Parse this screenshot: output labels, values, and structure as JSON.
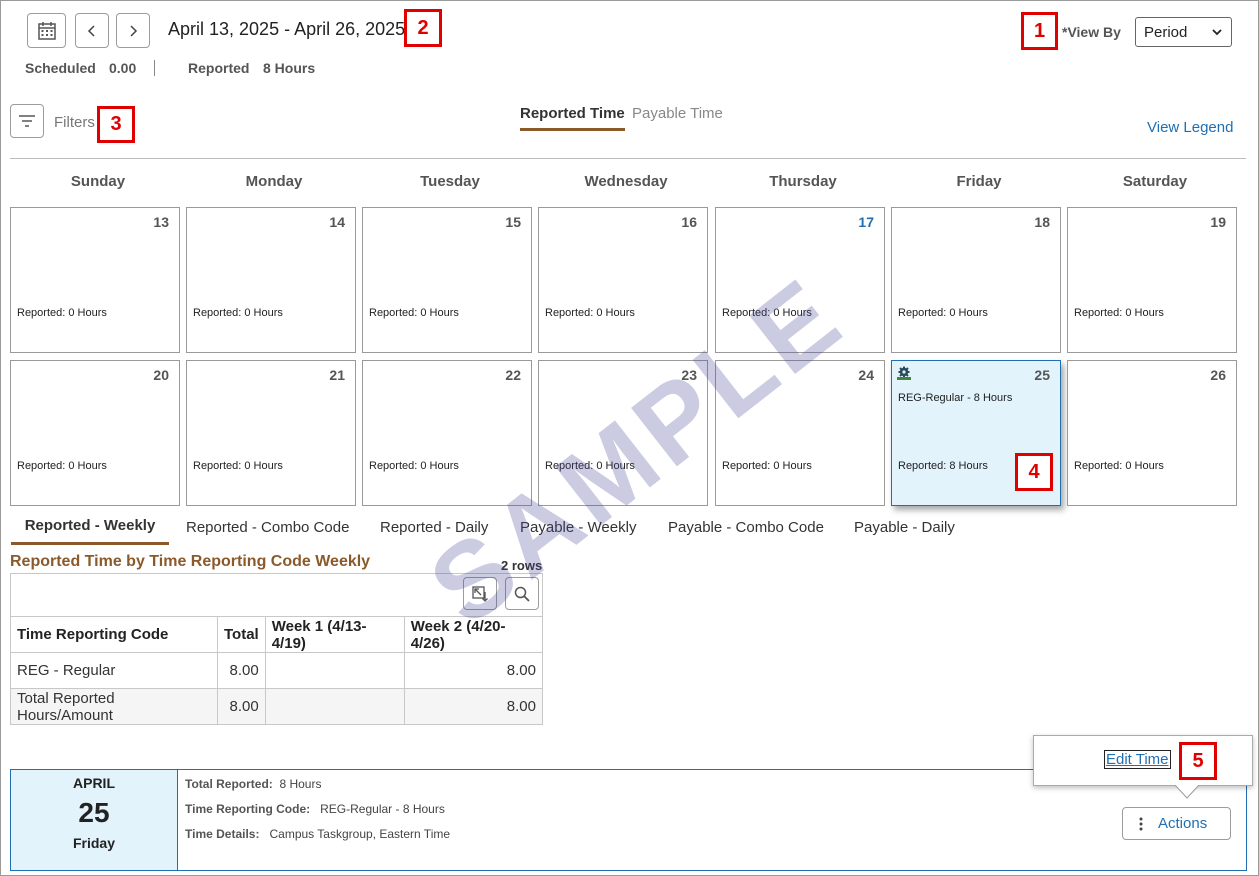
{
  "header": {
    "date_range": "April 13, 2025 - April 26, 2025",
    "view_by_label": "*View By",
    "view_by_value": "Period",
    "scheduled_label": "Scheduled",
    "scheduled_value": "0.00",
    "reported_label": "Reported",
    "reported_value": "8 Hours"
  },
  "filters_label": "Filters",
  "time_tabs": [
    "Reported Time",
    "Payable Time"
  ],
  "view_legend": "View Legend",
  "days": [
    "Sunday",
    "Monday",
    "Tuesday",
    "Wednesday",
    "Thursday",
    "Friday",
    "Saturday"
  ],
  "week1": [
    {
      "num": "13",
      "rep": "Reported: 0 Hours"
    },
    {
      "num": "14",
      "rep": "Reported: 0 Hours"
    },
    {
      "num": "15",
      "rep": "Reported: 0 Hours"
    },
    {
      "num": "16",
      "rep": "Reported: 0 Hours"
    },
    {
      "num": "17",
      "rep": "Reported: 0 Hours"
    },
    {
      "num": "18",
      "rep": "Reported: 0 Hours"
    },
    {
      "num": "19",
      "rep": "Reported: 0 Hours"
    }
  ],
  "week2": [
    {
      "num": "20",
      "rep": "Reported: 0 Hours"
    },
    {
      "num": "21",
      "rep": "Reported: 0 Hours"
    },
    {
      "num": "22",
      "rep": "Reported: 0 Hours"
    },
    {
      "num": "23",
      "rep": "Reported: 0 Hours"
    },
    {
      "num": "24",
      "rep": "Reported: 0 Hours"
    },
    {
      "num": "25",
      "rep": "Reported: 8 Hours",
      "entry": "REG-Regular - 8 Hours"
    },
    {
      "num": "26",
      "rep": "Reported: 0 Hours"
    }
  ],
  "summary_tabs": [
    "Reported - Weekly",
    "Reported - Combo Code",
    "Reported - Daily",
    "Payable - Weekly",
    "Payable - Combo Code",
    "Payable - Daily"
  ],
  "grid": {
    "title": "Reported Time by Time Reporting Code Weekly",
    "row_count": "2 rows",
    "headers": [
      "Time Reporting Code",
      "Total",
      "Week 1 (4/13-4/19)",
      "Week 2 (4/20-4/26)"
    ],
    "rows": [
      [
        "REG - Regular",
        "8.00",
        "",
        "8.00"
      ],
      [
        "Total Reported Hours/Amount",
        "8.00",
        "",
        "8.00"
      ]
    ]
  },
  "detail": {
    "month": "APRIL",
    "day": "25",
    "weekday": "Friday",
    "total_label": "Total Reported:",
    "total_value": "8 Hours",
    "trc_label": "Time Reporting Code:",
    "trc_value": "REG-Regular - 8 Hours",
    "details_label": "Time Details:",
    "details_value": "Campus Taskgroup, Eastern Time",
    "actions_label": "Actions",
    "edit_time": "Edit Time"
  },
  "watermark": "SAMPLE",
  "callouts": [
    "1",
    "2",
    "3",
    "4",
    "5"
  ],
  "colors": {
    "accent": "#1f6fb2",
    "tab_underline": "#8b5a2b",
    "callout": "#e00000",
    "selected_cell": "#e2f3fc"
  }
}
